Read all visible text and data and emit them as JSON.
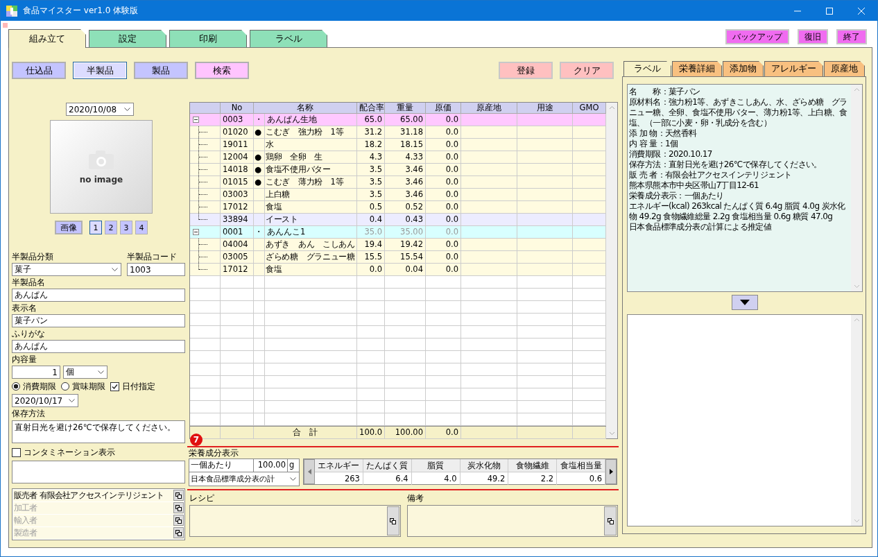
{
  "window": {
    "title": "食品マイスター ver1.0 体験版"
  },
  "main_tabs": [
    {
      "label": "組み立て",
      "selected": true
    },
    {
      "label": "設定",
      "selected": false
    },
    {
      "label": "印刷",
      "selected": false
    },
    {
      "label": "ラベル",
      "selected": false
    }
  ],
  "top_buttons": [
    "バックアップ",
    "復旧",
    "終了"
  ],
  "category_buttons": [
    {
      "label": "仕込品",
      "selected": false,
      "color": "#c4c4ff"
    },
    {
      "label": "半製品",
      "selected": true,
      "color": "#dcdcff"
    },
    {
      "label": "製品",
      "selected": false,
      "color": "#c4c4ff"
    },
    {
      "label": "検索",
      "selected": false,
      "color": "#ffc4ff"
    }
  ],
  "action_buttons": [
    "登録",
    "クリア"
  ],
  "image": {
    "date": "2020/10/08",
    "placeholder": "no image",
    "button": "画像",
    "pages": [
      {
        "label": "1",
        "selected": true
      },
      {
        "label": "2",
        "selected": false
      },
      {
        "label": "3",
        "selected": false
      },
      {
        "label": "4",
        "selected": false
      }
    ]
  },
  "form": {
    "category": {
      "label": "半製品分類",
      "value": "菓子"
    },
    "code": {
      "label": "半製品コード",
      "value": "1003"
    },
    "name": {
      "label": "半製品名",
      "value": "あんぱん"
    },
    "display_name": {
      "label": "表示名",
      "value": "菓子パン"
    },
    "furigana": {
      "label": "ふりがな",
      "value": "あんぱん"
    },
    "quantity": {
      "label": "内容量",
      "value": "1",
      "unit": "個"
    },
    "expiry_types": [
      {
        "label": "消費期限",
        "selected": true
      },
      {
        "label": "賞味期限",
        "selected": false
      }
    ],
    "date_specified": {
      "label": "日付指定",
      "checked": true
    },
    "expiry_date": "2020/10/17",
    "storage": {
      "label": "保存方法",
      "value": "直射日光を避け26℃で保存してください。"
    },
    "contamination": {
      "label": "コンタミネーション表示",
      "checked": false
    },
    "parties": [
      {
        "label": "販売者 有限会社アクセスインテリジェント",
        "disabled": false
      },
      {
        "label": "加工者",
        "disabled": true
      },
      {
        "label": "輸入者",
        "disabled": true
      },
      {
        "label": "製造者",
        "disabled": true
      }
    ]
  },
  "table": {
    "columns": [
      "No",
      "名称",
      "配合率",
      "重量",
      "原価",
      "原産地",
      "用途",
      "GMO"
    ],
    "groups": [
      {
        "no": "0003",
        "mark": "・",
        "name": "あんぱん生地",
        "rate": "65.0",
        "weight": "65.00",
        "cost": "0.0",
        "color": "#ffc8ff",
        "expanded": true,
        "dimmed": false,
        "children": [
          {
            "no": "01020",
            "mark": "●",
            "name": "こむぎ　強力粉　1等",
            "rate": "31.2",
            "weight": "31.18",
            "cost": "0.0",
            "selected": false
          },
          {
            "no": "19011",
            "name": "水",
            "rate": "18.2",
            "weight": "18.15",
            "cost": "0.0",
            "selected": false
          },
          {
            "no": "12004",
            "mark": "●",
            "name": "鶏卵　全卵　生",
            "rate": "4.3",
            "weight": "4.33",
            "cost": "0.0",
            "selected": false
          },
          {
            "no": "14018",
            "mark": "●",
            "name": "食塩不使用バター",
            "rate": "3.5",
            "weight": "3.46",
            "cost": "0.0",
            "selected": false
          },
          {
            "no": "01015",
            "mark": "●",
            "name": "こむぎ　薄力粉　1等",
            "rate": "3.5",
            "weight": "3.46",
            "cost": "0.0",
            "selected": false
          },
          {
            "no": "03003",
            "name": "上白糖",
            "rate": "3.5",
            "weight": "3.46",
            "cost": "0.0",
            "selected": false
          },
          {
            "no": "17012",
            "name": "食塩",
            "rate": "0.5",
            "weight": "0.52",
            "cost": "0.0",
            "selected": false
          },
          {
            "no": "33894",
            "name": "イースト",
            "rate": "0.4",
            "weight": "0.43",
            "cost": "0.0",
            "selected": true
          }
        ]
      },
      {
        "no": "0001",
        "mark": "・",
        "name": "あんんこ1",
        "rate": "35.0",
        "weight": "35.00",
        "cost": "0.0",
        "color": "#d8ffff",
        "expanded": true,
        "dimmed": true,
        "children": [
          {
            "no": "04004",
            "name": "あずき　あん　こしあん",
            "rate": "19.4",
            "weight": "19.42",
            "cost": "0.0",
            "selected": false
          },
          {
            "no": "03005",
            "name": "ざらめ糖　グラニュー糖",
            "rate": "15.5",
            "weight": "15.54",
            "cost": "0.0",
            "selected": false
          },
          {
            "no": "17012",
            "name": "食塩",
            "rate": "0.0",
            "weight": "0.04",
            "cost": "0.0",
            "selected": false
          }
        ]
      }
    ],
    "total": {
      "label": "合　計",
      "rate": "100.0",
      "weight": "100.00",
      "cost": "0.0"
    }
  },
  "nutrition": {
    "badge": "7",
    "title": "栄養成分表示",
    "basis": "一個あたり",
    "amount": "100.00",
    "unit": "g",
    "source": "日本食品標準成分表の計",
    "columns": [
      "エネルギー",
      "たんぱく質",
      "脂質",
      "炭水化物",
      "食物繊維",
      "食塩相当量"
    ],
    "values": [
      "263",
      "6.4",
      "4.0",
      "49.2",
      "2.2",
      "0.6"
    ]
  },
  "recipe": {
    "label": "レシピ"
  },
  "notes": {
    "label": "備考"
  },
  "side_tabs": [
    {
      "label": "ラベル",
      "selected": true
    },
    {
      "label": "栄養詳細",
      "selected": false
    },
    {
      "label": "添加物",
      "selected": false
    },
    {
      "label": "アレルギー",
      "selected": false
    },
    {
      "label": "原産地",
      "selected": false
    }
  ],
  "label_text": [
    "名　　称：菓子パン",
    "原材料名：強力粉1等、あずきこしあん、水、ざらめ糖　グラニュー糖、全卵、食塩不使用バター、薄力粉1等、上白糖、食塩、（一部に小麦・卵・乳成分を含む）",
    "添 加 物：天然香料",
    "内 容 量：1個",
    "消費期限：2020.10.17",
    "保存方法：直射日光を避け26℃で保存してください。",
    "販 売 者：有限会社アクセスインテリジェント",
    "熊本県熊本市中央区帯山7丁目12-61",
    "栄養成分表示：一個あたり",
    "エネルギー(kcal) 263kcal たんぱく質 6.4g 脂質 4.0g 炭水化物 49.2g 食物繊維総量 2.2g 食塩相当量 0.6g 糖質 47.0g",
    "日本食品標準成分表の計算による推定値"
  ]
}
